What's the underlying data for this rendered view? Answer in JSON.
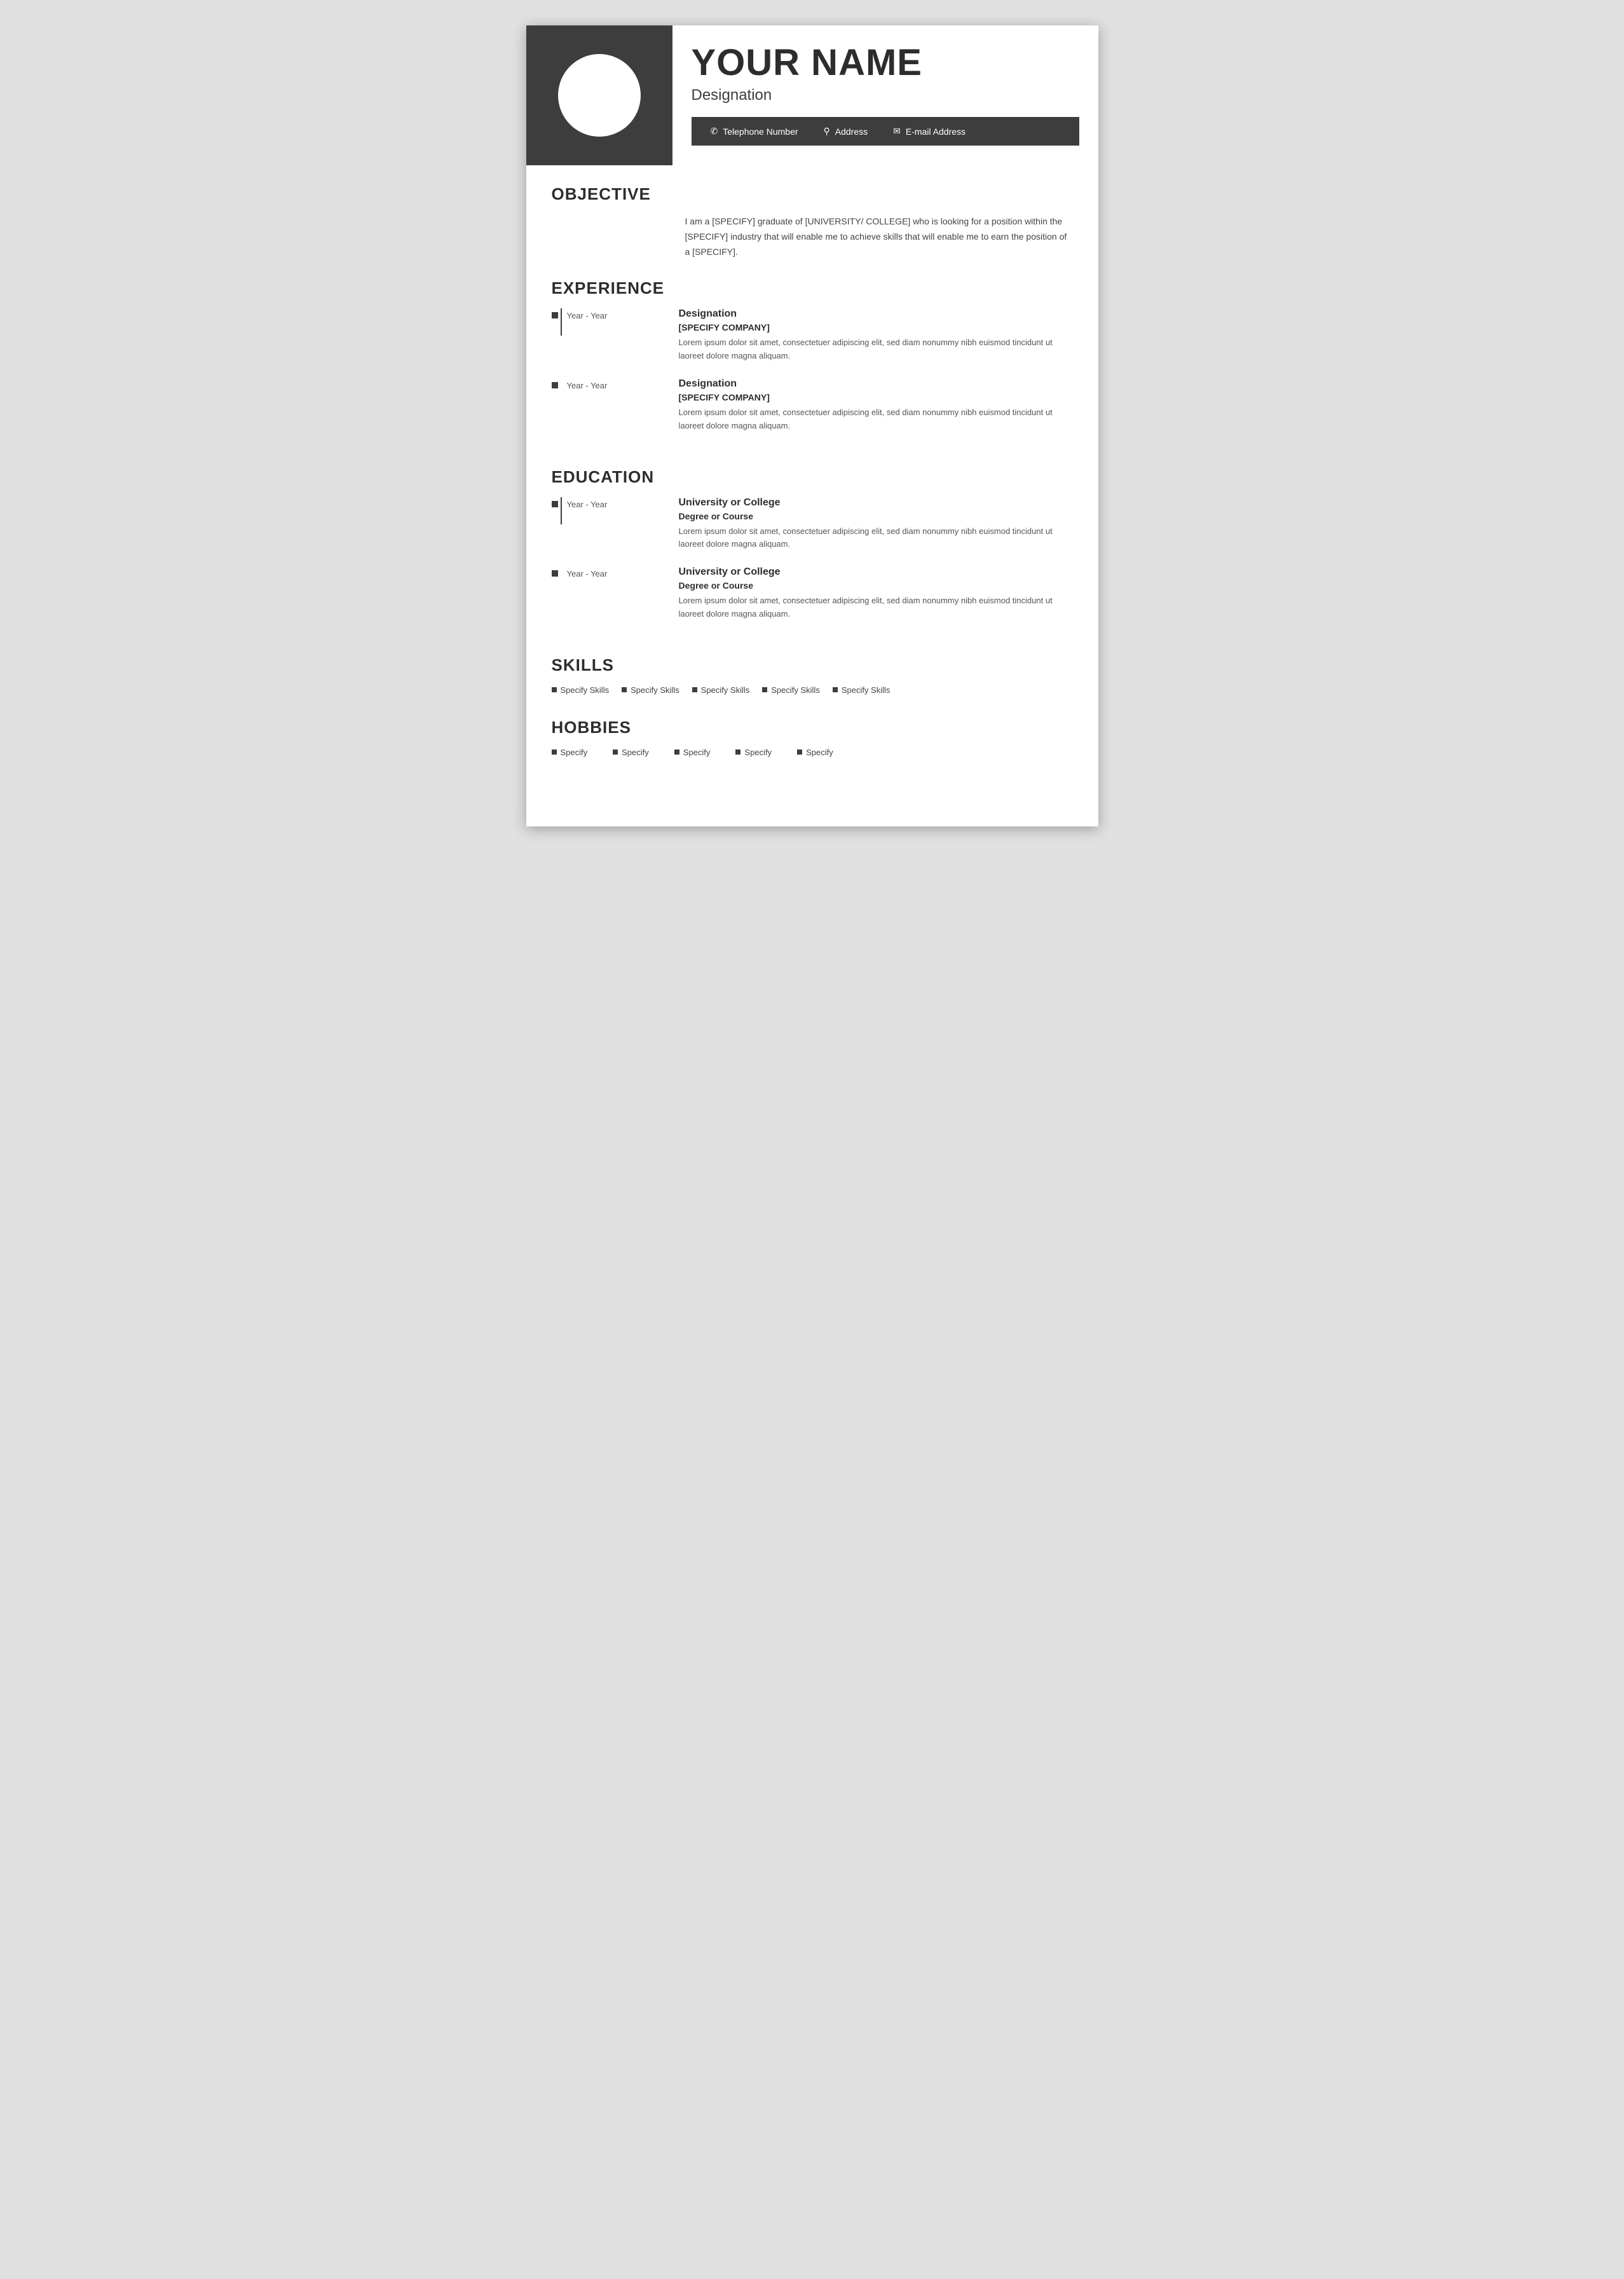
{
  "header": {
    "name": "YOUR NAME",
    "designation": "Designation",
    "contact": {
      "phone": "Telephone Number",
      "address": "Address",
      "email": "E-mail Address"
    }
  },
  "objective": {
    "title": "OBJECTIVE",
    "text": "I am a [SPECIFY] graduate of [UNIVERSITY/ COLLEGE] who is looking for a position within the [SPECIFY] industry that will enable me to achieve skills that will enable me to earn the position of a [SPECIFY]."
  },
  "experience": {
    "title": "EXPERIENCE",
    "entries": [
      {
        "years": "Year - Year",
        "designation": "Designation",
        "company": "[SPECIFY COMPANY]",
        "description": "Lorem ipsum dolor sit amet, consectetuer adipiscing elit, sed diam nonummy nibh euismod tincidunt ut laoreet dolore magna aliquam."
      },
      {
        "years": "Year - Year",
        "designation": "Designation",
        "company": "[SPECIFY COMPANY]",
        "description": "Lorem ipsum dolor sit amet, consectetuer adipiscing elit, sed diam nonummy nibh euismod tincidunt ut laoreet dolore magna aliquam."
      }
    ]
  },
  "education": {
    "title": "EDUCATION",
    "entries": [
      {
        "years": "Year - Year",
        "institution": "University or College",
        "degree": "Degree or Course",
        "description": "Lorem ipsum dolor sit amet, consectetuer adipiscing elit, sed diam nonummy nibh euismod tincidunt ut laoreet dolore magna aliquam."
      },
      {
        "years": "Year - Year",
        "institution": "University or College",
        "degree": "Degree or Course",
        "description": "Lorem ipsum dolor sit amet, consectetuer adipiscing elit, sed diam nonummy nibh euismod tincidunt ut laoreet dolore magna aliquam."
      }
    ]
  },
  "skills": {
    "title": "SKILLS",
    "items": [
      "Specify Skills",
      "Specify Skills",
      "Specify Skills",
      "Specify Skills",
      "Specify Skills"
    ]
  },
  "hobbies": {
    "title": "HOBBIES",
    "items": [
      "Specify",
      "Specify",
      "Specify",
      "Specify",
      "Specify"
    ]
  },
  "colors": {
    "dark": "#3d3d3d",
    "text": "#2d2d2d",
    "muted": "#555555",
    "white": "#ffffff"
  }
}
